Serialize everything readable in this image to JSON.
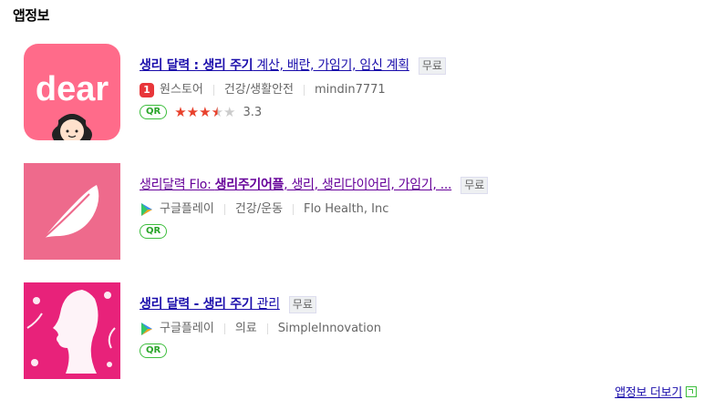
{
  "section": {
    "title": "앱정보"
  },
  "apps": [
    {
      "title_bold1": "생리 달력 : 생리 주기",
      "title_rest": " 계산, 배란, 가임기, 임신 계획",
      "badge": "무료",
      "store": "원스토어",
      "category": "건강/생활안전",
      "developer": "mindin7771",
      "qr": "QR",
      "rating": "3.3",
      "rating_value": 3.3,
      "icon_text": "dear",
      "icon_color": "#ff6b8a"
    },
    {
      "title_prefix": "생리달력 Flo: ",
      "title_bold": "생리주기어플",
      "title_rest": ", 생리, 생리다이어리, 가임기, ...",
      "badge": "무료",
      "store": "구글플레이",
      "category": "건강/운동",
      "developer": "Flo Health, Inc",
      "qr": "QR",
      "icon_color": "#ee6a8c"
    },
    {
      "title_bold1": "생리 달력",
      "title_mid": " - ",
      "title_bold2": "생리 주기",
      "title_rest": " 관리",
      "badge": "무료",
      "store": "구글플레이",
      "category": "의료",
      "developer": "SimpleInnovation",
      "qr": "QR",
      "icon_color": "#e8227a"
    }
  ],
  "more_link": "앱정보 더보기"
}
